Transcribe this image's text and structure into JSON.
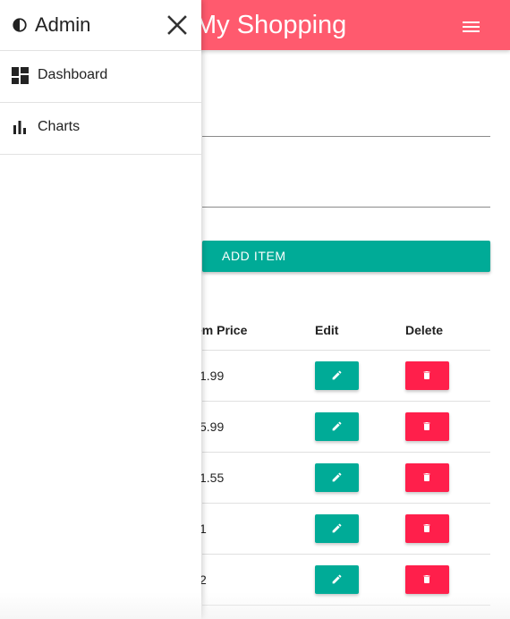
{
  "app": {
    "title": "My Shopping",
    "header_color": "#ff5a6e"
  },
  "drawer": {
    "title": "Admin",
    "logo_icon": "contrast-icon",
    "close_icon": "close-icon",
    "items": [
      {
        "label": "Dashboard",
        "icon": "dashboard-icon"
      },
      {
        "label": "Charts",
        "icon": "bar-chart-icon"
      }
    ]
  },
  "form": {
    "add_button_label": "ADD ITEM",
    "accent_color": "#00ab97"
  },
  "table": {
    "columns": [
      "em Price",
      "Edit",
      "Delete"
    ],
    "rows": [
      {
        "price": "1.99"
      },
      {
        "price": "5.99"
      },
      {
        "price": "1.55"
      },
      {
        "price": "1"
      },
      {
        "price": "2"
      }
    ],
    "edit_color": "#00ab97",
    "delete_color": "#ff1f4b"
  }
}
